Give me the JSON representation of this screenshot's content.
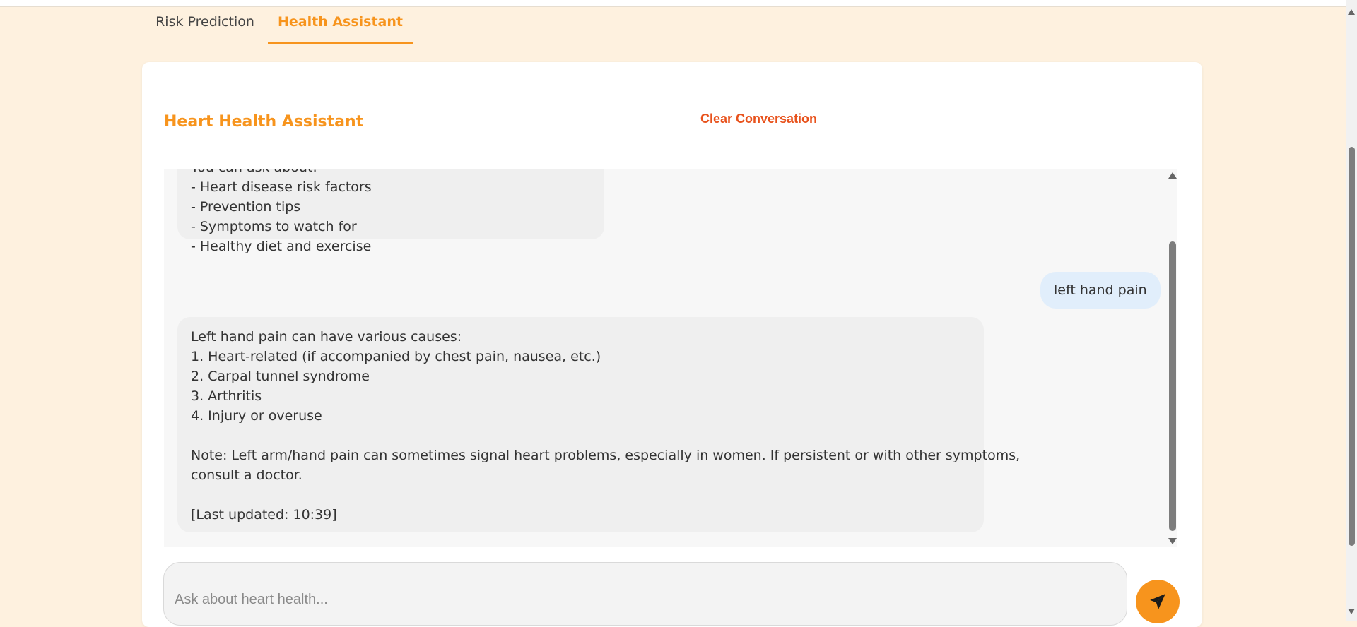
{
  "tabs": [
    {
      "label": "Risk Prediction"
    },
    {
      "label": "Health Assistant"
    }
  ],
  "assistant": {
    "title": "Heart Health Assistant",
    "clear_label": "Clear Conversation"
  },
  "messages": {
    "intro_lines": [
      "You can ask about:",
      "- Heart disease risk factors",
      "- Prevention tips",
      "- Symptoms to watch for",
      "- Healthy diet and exercise"
    ],
    "user_message": "left hand pain",
    "reply_lines": [
      "Left hand pain can have various causes:",
      "1. Heart-related (if accompanied by chest pain, nausea, etc.)",
      "2. Carpal tunnel syndrome",
      "3. Arthritis",
      "4. Injury or overuse",
      "Note: Left arm/hand pain can sometimes signal heart problems, especially in women. If persistent or with other symptoms,",
      "consult a doctor.",
      "[Last updated: 10:39]"
    ]
  },
  "input": {
    "placeholder": "Ask about heart health...",
    "value": ""
  },
  "icons": {
    "send": "paper-plane-icon"
  },
  "colors": {
    "accent": "#f7941d",
    "clear": "#e8521c",
    "background": "#fef1df",
    "user_bubble": "#e1eefb",
    "bot_bubble": "#efefef"
  }
}
